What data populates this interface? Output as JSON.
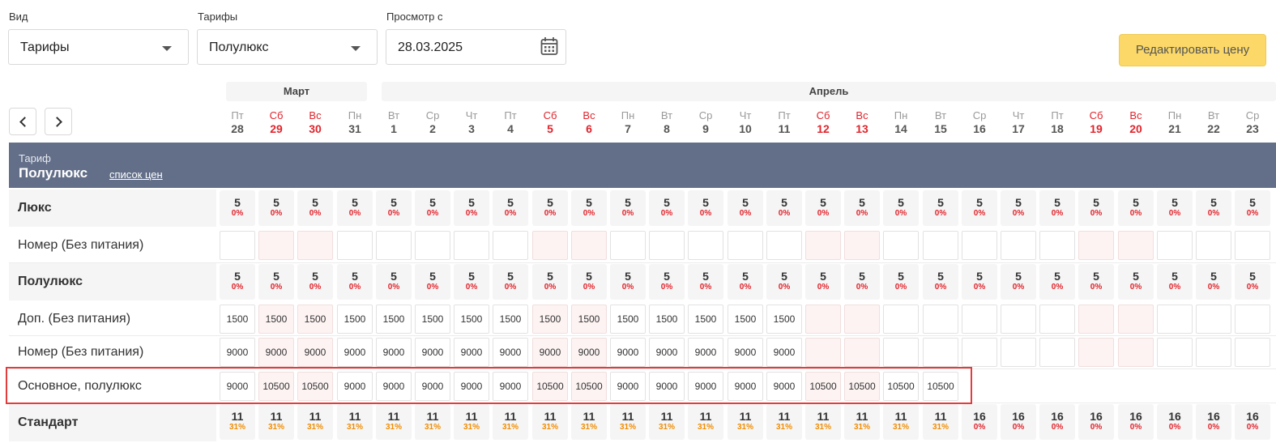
{
  "filters": {
    "view": {
      "label": "Вид",
      "value": "Тарифы"
    },
    "tariffs": {
      "label": "Тарифы",
      "value": "Полулюкс"
    },
    "date": {
      "label": "Просмотр с",
      "value": "28.03.2025"
    }
  },
  "edit_button": "Редактировать цену",
  "months": [
    {
      "name": "Март"
    },
    {
      "name": "Апрель"
    }
  ],
  "days": [
    {
      "dn": "Пт",
      "dd": "28",
      "we": false
    },
    {
      "dn": "Сб",
      "dd": "29",
      "we": true
    },
    {
      "dn": "Вс",
      "dd": "30",
      "we": true
    },
    {
      "dn": "Пн",
      "dd": "31",
      "we": false
    },
    {
      "dn": "Вт",
      "dd": "1",
      "we": false
    },
    {
      "dn": "Ср",
      "dd": "2",
      "we": false
    },
    {
      "dn": "Чт",
      "dd": "3",
      "we": false
    },
    {
      "dn": "Пт",
      "dd": "4",
      "we": false
    },
    {
      "dn": "Сб",
      "dd": "5",
      "we": true
    },
    {
      "dn": "Вс",
      "dd": "6",
      "we": true
    },
    {
      "dn": "Пн",
      "dd": "7",
      "we": false
    },
    {
      "dn": "Вт",
      "dd": "8",
      "we": false
    },
    {
      "dn": "Ср",
      "dd": "9",
      "we": false
    },
    {
      "dn": "Чт",
      "dd": "10",
      "we": false
    },
    {
      "dn": "Пт",
      "dd": "11",
      "we": false
    },
    {
      "dn": "Сб",
      "dd": "12",
      "we": true
    },
    {
      "dn": "Вс",
      "dd": "13",
      "we": true
    },
    {
      "dn": "Пн",
      "dd": "14",
      "we": false
    },
    {
      "dn": "Вт",
      "dd": "15",
      "we": false
    },
    {
      "dn": "Ср",
      "dd": "16",
      "we": false
    },
    {
      "dn": "Чт",
      "dd": "17",
      "we": false
    },
    {
      "dn": "Пт",
      "dd": "18",
      "we": false
    },
    {
      "dn": "Сб",
      "dd": "19",
      "we": true
    },
    {
      "dn": "Вс",
      "dd": "20",
      "we": true
    },
    {
      "dn": "Пн",
      "dd": "21",
      "we": false
    },
    {
      "dn": "Вт",
      "dd": "22",
      "we": false
    },
    {
      "dn": "Ср",
      "dd": "23",
      "we": false
    }
  ],
  "tariff_banner": {
    "caption": "Тариф",
    "name": "Полулюкс",
    "link": "список цен"
  },
  "rows": [
    {
      "type": "cat",
      "label": "Люкс",
      "cells": [
        [
          "5",
          "0%"
        ],
        [
          "5",
          "0%"
        ],
        [
          "5",
          "0%"
        ],
        [
          "5",
          "0%"
        ],
        [
          "5",
          "0%"
        ],
        [
          "5",
          "0%"
        ],
        [
          "5",
          "0%"
        ],
        [
          "5",
          "0%"
        ],
        [
          "5",
          "0%"
        ],
        [
          "5",
          "0%"
        ],
        [
          "5",
          "0%"
        ],
        [
          "5",
          "0%"
        ],
        [
          "5",
          "0%"
        ],
        [
          "5",
          "0%"
        ],
        [
          "5",
          "0%"
        ],
        [
          "5",
          "0%"
        ],
        [
          "5",
          "0%"
        ],
        [
          "5",
          "0%"
        ],
        [
          "5",
          "0%"
        ],
        [
          "5",
          "0%"
        ],
        [
          "5",
          "0%"
        ],
        [
          "5",
          "0%"
        ],
        [
          "5",
          "0%"
        ],
        [
          "5",
          "0%"
        ],
        [
          "5",
          "0%"
        ],
        [
          "5",
          "0%"
        ],
        [
          "5",
          "0%"
        ]
      ]
    },
    {
      "type": "line",
      "label": "Номер (Без питания)",
      "cells": [
        "",
        "",
        "",
        "",
        "",
        "",
        "",
        "",
        "",
        "",
        "",
        "",
        "",
        "",
        "",
        "",
        "",
        "",
        "",
        "",
        "",
        "",
        "",
        "",
        "",
        "",
        ""
      ]
    },
    {
      "type": "cat",
      "label": "Полулюкс",
      "cells": [
        [
          "5",
          "0%"
        ],
        [
          "5",
          "0%"
        ],
        [
          "5",
          "0%"
        ],
        [
          "5",
          "0%"
        ],
        [
          "5",
          "0%"
        ],
        [
          "5",
          "0%"
        ],
        [
          "5",
          "0%"
        ],
        [
          "5",
          "0%"
        ],
        [
          "5",
          "0%"
        ],
        [
          "5",
          "0%"
        ],
        [
          "5",
          "0%"
        ],
        [
          "5",
          "0%"
        ],
        [
          "5",
          "0%"
        ],
        [
          "5",
          "0%"
        ],
        [
          "5",
          "0%"
        ],
        [
          "5",
          "0%"
        ],
        [
          "5",
          "0%"
        ],
        [
          "5",
          "0%"
        ],
        [
          "5",
          "0%"
        ],
        [
          "5",
          "0%"
        ],
        [
          "5",
          "0%"
        ],
        [
          "5",
          "0%"
        ],
        [
          "5",
          "0%"
        ],
        [
          "5",
          "0%"
        ],
        [
          "5",
          "0%"
        ],
        [
          "5",
          "0%"
        ],
        [
          "5",
          "0%"
        ]
      ]
    },
    {
      "type": "line",
      "label": "Доп. (Без питания)",
      "cells": [
        "1500",
        "1500",
        "1500",
        "1500",
        "1500",
        "1500",
        "1500",
        "1500",
        "1500",
        "1500",
        "1500",
        "1500",
        "1500",
        "1500",
        "1500",
        "",
        "",
        "",
        "",
        "",
        "",
        "",
        "",
        "",
        "",
        "",
        ""
      ]
    },
    {
      "type": "line",
      "label": "Номер (Без питания)",
      "cells": [
        "9000",
        "9000",
        "9000",
        "9000",
        "9000",
        "9000",
        "9000",
        "9000",
        "9000",
        "9000",
        "9000",
        "9000",
        "9000",
        "9000",
        "9000",
        "",
        "",
        "",
        "",
        "",
        "",
        "",
        "",
        "",
        "",
        "",
        ""
      ]
    },
    {
      "type": "main",
      "label": "Основное, полулюкс",
      "cells": [
        "9000",
        "10500",
        "10500",
        "9000",
        "9000",
        "9000",
        "9000",
        "9000",
        "10500",
        "10500",
        "9000",
        "9000",
        "9000",
        "9000",
        "9000",
        "10500",
        "10500",
        "10500",
        "10500"
      ]
    },
    {
      "type": "cat",
      "label": "Стандарт",
      "cells": [
        [
          "11",
          "31%"
        ],
        [
          "11",
          "31%"
        ],
        [
          "11",
          "31%"
        ],
        [
          "11",
          "31%"
        ],
        [
          "11",
          "31%"
        ],
        [
          "11",
          "31%"
        ],
        [
          "11",
          "31%"
        ],
        [
          "11",
          "31%"
        ],
        [
          "11",
          "31%"
        ],
        [
          "11",
          "31%"
        ],
        [
          "11",
          "31%"
        ],
        [
          "11",
          "31%"
        ],
        [
          "11",
          "31%"
        ],
        [
          "11",
          "31%"
        ],
        [
          "11",
          "31%"
        ],
        [
          "11",
          "31%"
        ],
        [
          "11",
          "31%"
        ],
        [
          "11",
          "31%"
        ],
        [
          "11",
          "31%"
        ],
        [
          "16",
          "0%"
        ],
        [
          "16",
          "0%"
        ],
        [
          "16",
          "0%"
        ],
        [
          "16",
          "0%"
        ],
        [
          "16",
          "0%"
        ],
        [
          "16",
          "0%"
        ],
        [
          "16",
          "0%"
        ],
        [
          "16",
          "0%"
        ]
      ]
    }
  ],
  "colors": {
    "weekend": "#e0242c",
    "occupancy_low": "#e0242c",
    "occupancy_mid": "#f08c00",
    "banner": "#636f89",
    "button": "#fbd867",
    "highlight": "#e23c3c"
  }
}
